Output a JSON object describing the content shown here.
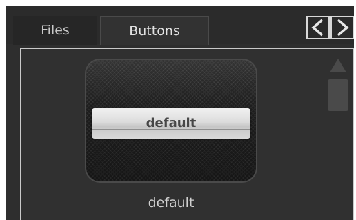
{
  "tabs": [
    {
      "label": "Files",
      "selected": false
    },
    {
      "label": "Buttons",
      "selected": true
    }
  ],
  "nav": {
    "prev_icon": "chevron-left-icon",
    "next_icon": "chevron-right-icon"
  },
  "preview": {
    "button_label": "default",
    "caption": "default"
  },
  "scrollbar": {
    "up_icon": "triangle-up-icon"
  }
}
